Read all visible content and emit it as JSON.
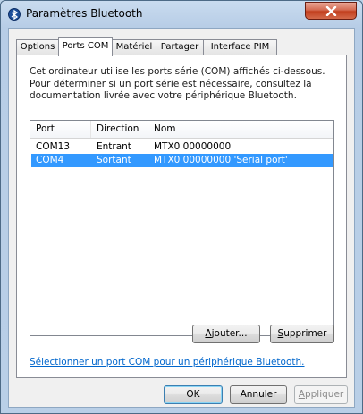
{
  "window": {
    "title": "Paramètres Bluetooth",
    "icon": "bluetooth-icon",
    "close_icon": "close-icon"
  },
  "tabs": [
    {
      "label": "Options",
      "active": false
    },
    {
      "label": "Ports COM",
      "active": true
    },
    {
      "label": "Matériel",
      "active": false
    },
    {
      "label": "Partager",
      "active": false
    },
    {
      "label": "Interface PIM",
      "active": false
    }
  ],
  "panel": {
    "description": "Cet ordinateur utilise les ports série (COM) affichés ci-dessous. Pour déterminer si un port série est nécessaire, consultez la documentation livrée avec votre périphérique Bluetooth.",
    "columns": [
      "Port",
      "Direction",
      "Nom"
    ],
    "rows": [
      {
        "port": "COM13",
        "direction": "Entrant",
        "name": "MTX0 00000000",
        "selected": false
      },
      {
        "port": "COM4",
        "direction": "Sortant",
        "name": "MTX0 00000000 'Serial port'",
        "selected": true
      }
    ],
    "add_button": {
      "prefix": "",
      "accel": "A",
      "suffix": "jouter..."
    },
    "remove_button": {
      "prefix": "",
      "accel": "S",
      "suffix": "upprimer"
    },
    "link": "Sélectionner un port COM pour un périphérique Bluetooth."
  },
  "footer": {
    "ok": "OK",
    "cancel": "Annuler",
    "apply_accel": "A",
    "apply_rest": "ppliquer"
  },
  "colors": {
    "selection": "#3399ff",
    "link": "#0066cc"
  }
}
